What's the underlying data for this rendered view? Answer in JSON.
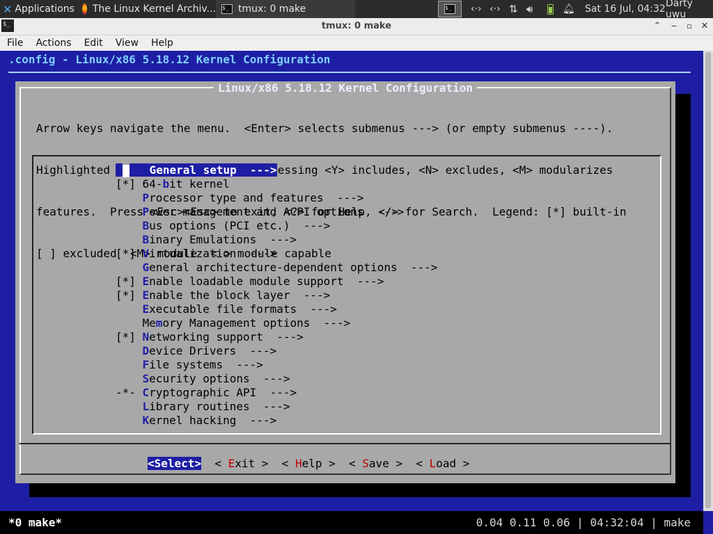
{
  "panel": {
    "applications_label": "Applications",
    "tasks": [
      {
        "title": "The Linux Kernel Archiv..."
      },
      {
        "title": "tmux: 0 make"
      }
    ],
    "network_icons": [
      "‹·›",
      "‹·›"
    ],
    "clock": "Sat 16 Jul, 04:32",
    "user": "Darty uwu"
  },
  "window": {
    "title": "tmux: 0 make",
    "menu": [
      "File",
      "Actions",
      "Edit",
      "View",
      "Help"
    ]
  },
  "terminal": {
    "header": ".config - Linux/x86 5.18.12 Kernel Configuration",
    "dialog_title": "Linux/x86 5.18.12 Kernel Configuration",
    "intro": [
      "Arrow keys navigate the menu.  <Enter> selects submenus ---> (or empty submenus ----).",
      "Highlighted letters are hotkeys.  Pressing <Y> includes, <N> excludes, <M> modularizes",
      "features.  Press <Esc><Esc> to exit, <?> for Help, </> for Search.  Legend: [*] built-in",
      "[ ] excluded  <M> module  < > module capable"
    ],
    "menu_items": [
      {
        "marker": "    ",
        "pre": "",
        "hot": "G",
        "post": "eneral setup  --->",
        "selected": true
      },
      {
        "marker": "[*] ",
        "pre": "64-",
        "hot": "b",
        "post": "it kernel",
        "selected": false
      },
      {
        "marker": "    ",
        "pre": "",
        "hot": "P",
        "post": "rocessor type and features  --->",
        "selected": false
      },
      {
        "marker": "    ",
        "pre": "",
        "hot": "P",
        "post": "ower management and ACPI options  --->",
        "selected": false
      },
      {
        "marker": "    ",
        "pre": "",
        "hot": "B",
        "post": "us options (PCI etc.)  --->",
        "selected": false
      },
      {
        "marker": "    ",
        "pre": "",
        "hot": "B",
        "post": "inary Emulations  --->",
        "selected": false
      },
      {
        "marker": "[*] ",
        "pre": "",
        "hot": "V",
        "post": "irtualization  --->",
        "selected": false
      },
      {
        "marker": "    ",
        "pre": "",
        "hot": "G",
        "post": "eneral architecture-dependent options  --->",
        "selected": false
      },
      {
        "marker": "[*] ",
        "pre": "",
        "hot": "E",
        "post": "nable loadable module support  --->",
        "selected": false
      },
      {
        "marker": "[*] ",
        "pre": "",
        "hot": "E",
        "post": "nable the block layer  --->",
        "selected": false
      },
      {
        "marker": "    ",
        "pre": "",
        "hot": "E",
        "post": "xecutable file formats  --->",
        "selected": false
      },
      {
        "marker": "    ",
        "pre": "Me",
        "hot": "m",
        "post": "ory Management options  --->",
        "selected": false
      },
      {
        "marker": "[*] ",
        "pre": "",
        "hot": "N",
        "post": "etworking support  --->",
        "selected": false
      },
      {
        "marker": "    ",
        "pre": "",
        "hot": "D",
        "post": "evice Drivers  --->",
        "selected": false
      },
      {
        "marker": "    ",
        "pre": "",
        "hot": "F",
        "post": "ile systems  --->",
        "selected": false
      },
      {
        "marker": "    ",
        "pre": "",
        "hot": "S",
        "post": "ecurity options  --->",
        "selected": false
      },
      {
        "marker": "-*- ",
        "pre": "",
        "hot": "C",
        "post": "ryptographic API  --->",
        "selected": false
      },
      {
        "marker": "    ",
        "pre": "",
        "hot": "L",
        "post": "ibrary routines  --->",
        "selected": false
      },
      {
        "marker": "    ",
        "pre": "",
        "hot": "K",
        "post": "ernel hacking  --->",
        "selected": false
      }
    ],
    "buttons": [
      {
        "label": "<Select>",
        "selected": true
      },
      {
        "pre": "< ",
        "hot": "E",
        "post": "xit >",
        "selected": false
      },
      {
        "pre": "< ",
        "hot": "H",
        "post": "elp >",
        "selected": false
      },
      {
        "pre": "< ",
        "hot": "S",
        "post": "ave >",
        "selected": false
      },
      {
        "pre": "< ",
        "hot": "L",
        "post": "oad >",
        "selected": false
      }
    ],
    "status_left": "*0 make*",
    "status_right": "0.04 0.11 0.06 | 04:32:04 | make"
  },
  "colors": {
    "terminal_blue": "#1e1ea4",
    "dialog_gray": "#a8a8a8",
    "hotkey_red": "#b00000",
    "header_cyan": "#80cfff"
  }
}
